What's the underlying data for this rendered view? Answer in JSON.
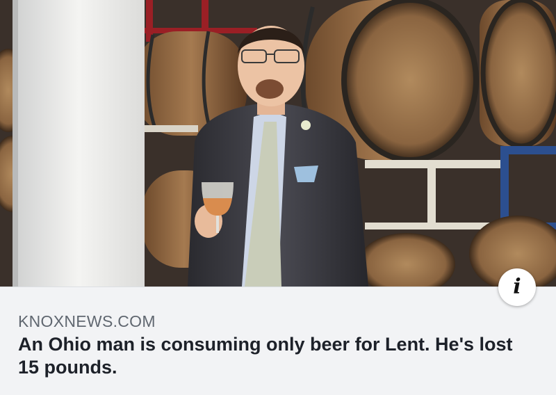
{
  "post": {
    "image": {
      "alt": ""
    },
    "info_icon": "info-icon",
    "source": "KNOXNEWS.COM",
    "headline": "An Ohio man is consuming only beer for Lent. He's lost 15 pounds."
  },
  "colors": {
    "caption_bg": "#f2f3f5",
    "domain_text": "#606770",
    "headline_text": "#1d2129"
  }
}
